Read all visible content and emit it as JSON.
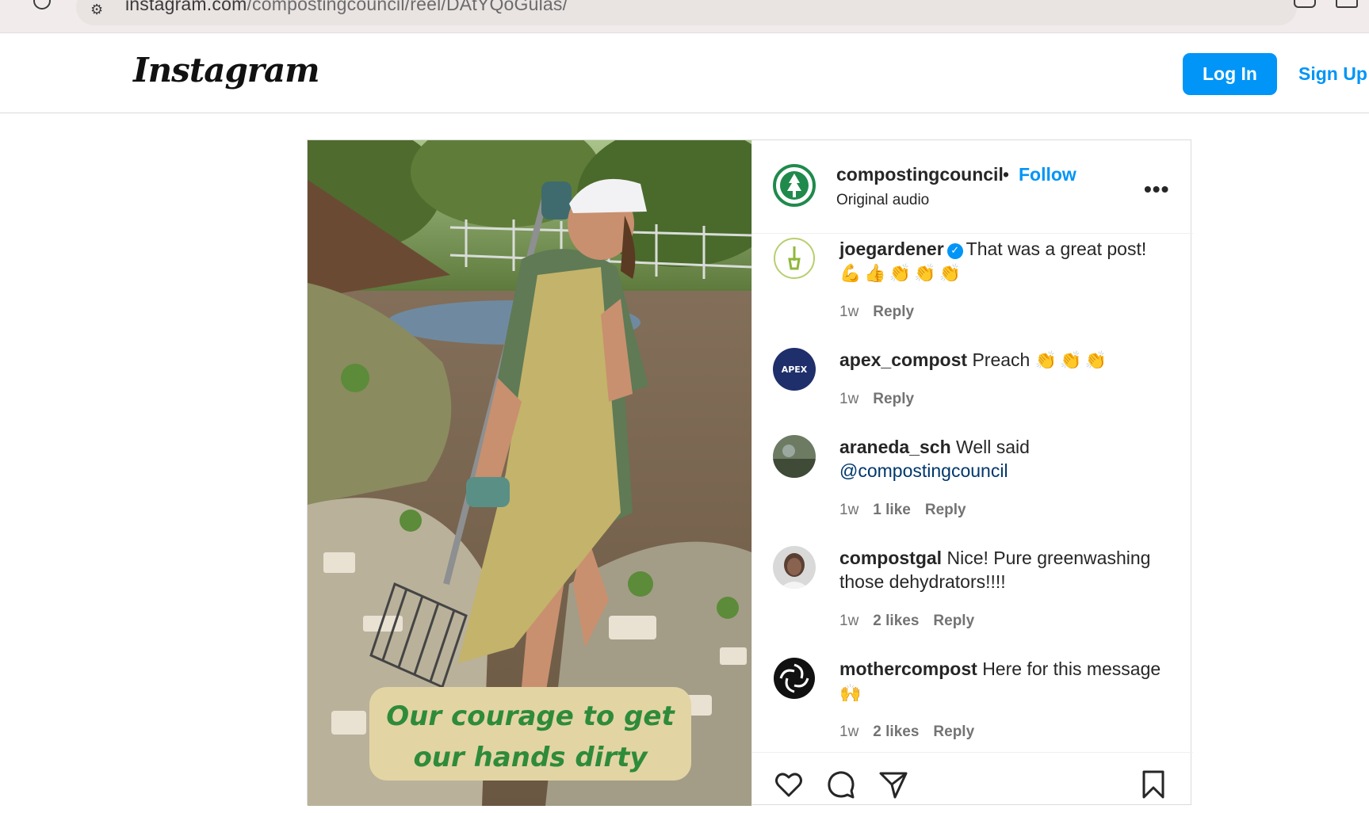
{
  "browser": {
    "url_host": "instagram.com",
    "url_path": "/compostingcouncil/reel/DAtYQoGulas/"
  },
  "header": {
    "logo": "Instagram",
    "login_label": "Log In",
    "signup_label": "Sign Up"
  },
  "post": {
    "owner": "compostingcouncil",
    "separator": "•",
    "follow_label": "Follow",
    "audio": "Original audio",
    "more": "•••",
    "video_caption_line1": "Our courage to get",
    "video_caption_line2": "our hands dirty"
  },
  "comments": [
    {
      "user": "joegardener",
      "verified": true,
      "text": "That was a great post!",
      "emoji": "💪👍👏👏👏",
      "time": "1w",
      "likes": "",
      "reply": "Reply"
    },
    {
      "user": "apex_compost",
      "verified": false,
      "text": "Preach",
      "emoji": "👏👏👏",
      "time": "1w",
      "likes": "",
      "reply": "Reply",
      "avatar_text": "APEX"
    },
    {
      "user": "araneda_sch",
      "verified": false,
      "text": "Well said",
      "mention": "@compostingcouncil",
      "time": "1w",
      "likes": "1 like",
      "reply": "Reply"
    },
    {
      "user": "compostgal",
      "verified": false,
      "text": "Nice! Pure greenwashing those dehydrators!!!!",
      "time": "1w",
      "likes": "2 likes",
      "reply": "Reply"
    },
    {
      "user": "mothercompost",
      "verified": false,
      "text": "Here for this message",
      "emoji": "🙌",
      "time": "1w",
      "likes": "2 likes",
      "reply": "Reply"
    }
  ],
  "actions": [
    "heart-icon",
    "comment-icon",
    "share-icon",
    "bookmark-icon"
  ],
  "colors": {
    "accent": "#0095f6",
    "caption_text": "#2e8b3a",
    "caption_bg": "#e3d4a4"
  }
}
